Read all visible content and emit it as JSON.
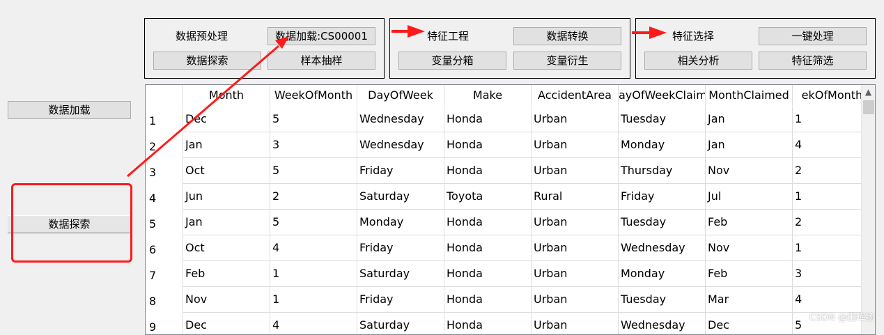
{
  "left_panel": {
    "load_button": "数据加载",
    "explore_button": "数据探索"
  },
  "group1": {
    "title": "数据预处理",
    "load_status_button": "数据加载:CS00001",
    "explore_button": "数据探索",
    "sample_button": "样本抽样"
  },
  "group2": {
    "title": "特征工程",
    "transform_button": "数据转换",
    "binning_button": "变量分箱",
    "derive_button": "变量衍生"
  },
  "group3": {
    "title": "特征选择",
    "one_click_button": "一键处理",
    "correlation_button": "相关分析",
    "filter_button": "特征筛选"
  },
  "table": {
    "columns": [
      "Month",
      "WeekOfMonth",
      "DayOfWeek",
      "Make",
      "AccidentArea",
      "ayOfWeekClaime",
      "MonthClaimed",
      "ekOfMonthC"
    ],
    "rows": [
      [
        "1",
        "Dec",
        "5",
        "Wednesday",
        "Honda",
        "Urban",
        "Tuesday",
        "Jan",
        "1"
      ],
      [
        "2",
        "Jan",
        "3",
        "Wednesday",
        "Honda",
        "Urban",
        "Monday",
        "Jan",
        "4"
      ],
      [
        "3",
        "Oct",
        "5",
        "Friday",
        "Honda",
        "Urban",
        "Thursday",
        "Nov",
        "2"
      ],
      [
        "4",
        "Jun",
        "2",
        "Saturday",
        "Toyota",
        "Rural",
        "Friday",
        "Jul",
        "1"
      ],
      [
        "5",
        "Jan",
        "5",
        "Monday",
        "Honda",
        "Urban",
        "Tuesday",
        "Feb",
        "2"
      ],
      [
        "6",
        "Oct",
        "4",
        "Friday",
        "Honda",
        "Urban",
        "Wednesday",
        "Nov",
        "1"
      ],
      [
        "7",
        "Feb",
        "1",
        "Saturday",
        "Honda",
        "Urban",
        "Monday",
        "Feb",
        "3"
      ],
      [
        "8",
        "Nov",
        "1",
        "Friday",
        "Honda",
        "Urban",
        "Tuesday",
        "Mar",
        "4"
      ],
      [
        "9",
        "Dec",
        "4",
        "Saturday",
        "Honda",
        "Urban",
        "Wednesday",
        "Dec",
        "5"
      ]
    ]
  },
  "scrollbar": {
    "up_icon": "▲"
  },
  "watermark": "CSDN @田晖扬",
  "colors": {
    "annotation_red": "#ff1a1a",
    "button_bg": "#e1e1e1"
  }
}
